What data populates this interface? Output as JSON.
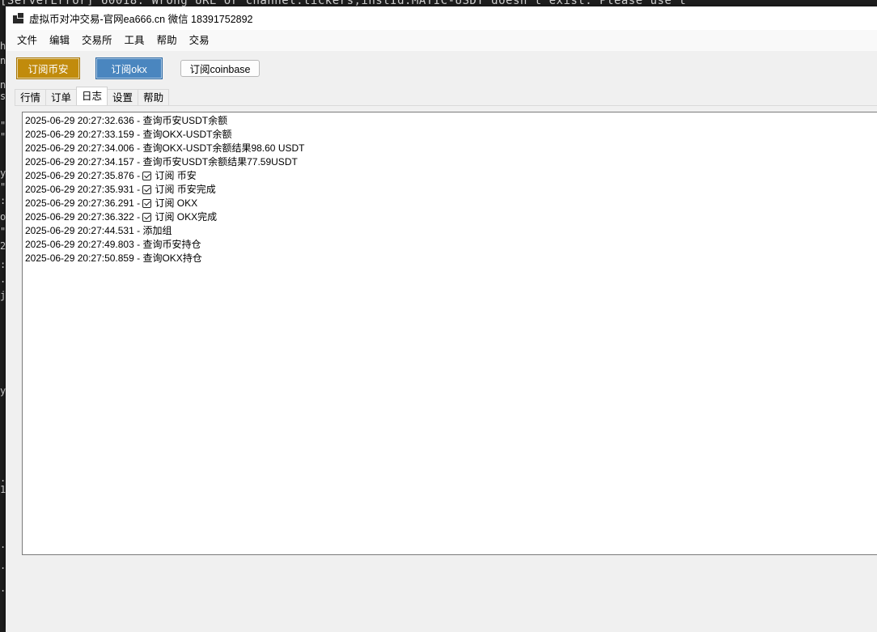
{
  "terminal": {
    "top_line": "[ServerError] 60018: Wrong URL or channel:tickers,instId:MATIC-USDT doesn't exist. Please use t",
    "left_glyphs": [
      "h",
      "n",
      "n",
      "s",
      "\"",
      "\"",
      "y",
      "\"",
      ":",
      "o",
      "\"",
      "2",
      ":",
      ".",
      "j",
      "y",
      ".",
      "1",
      ".",
      ".",
      "."
    ]
  },
  "window": {
    "title": "虚拟币对冲交易-官网ea666.cn 微信 18391752892",
    "menu": [
      "文件",
      "编辑",
      "交易所",
      "工具",
      "帮助",
      "交易"
    ],
    "toolbar": {
      "binance_label": "订阅币安",
      "okx_label": "订阅okx",
      "coinbase_label": "订阅coinbase"
    },
    "tabs": [
      "行情",
      "订单",
      "日志",
      "设置",
      "帮助"
    ],
    "active_tab": "日志",
    "log_lines": [
      {
        "text": "2025-06-29 20:27:32.636 - 查询币安USDT余额",
        "checked": false
      },
      {
        "text": "2025-06-29 20:27:33.159 - 查询OKX-USDT余额",
        "checked": false
      },
      {
        "text": "2025-06-29 20:27:34.006 - 查询OKX-USDT余额结果98.60 USDT",
        "checked": false
      },
      {
        "text": "2025-06-29 20:27:34.157 - 查询币安USDT余额结果77.59USDT",
        "checked": false
      },
      {
        "prefix": "2025-06-29 20:27:35.876 - ",
        "text": "订阅 币安",
        "checked": true
      },
      {
        "prefix": "2025-06-29 20:27:35.931 - ",
        "text": "订阅 币安完成",
        "checked": true
      },
      {
        "prefix": "2025-06-29 20:27:36.291 - ",
        "text": "订阅 OKX",
        "checked": true
      },
      {
        "prefix": "2025-06-29 20:27:36.322 - ",
        "text": "订阅 OKX完成",
        "checked": true
      },
      {
        "text": "2025-06-29 20:27:44.531 - 添加组",
        "checked": false
      },
      {
        "text": "2025-06-29 20:27:49.803 - 查询币安持仓",
        "checked": false
      },
      {
        "text": "2025-06-29 20:27:50.859 - 查询OKX持仓",
        "checked": false
      }
    ]
  }
}
